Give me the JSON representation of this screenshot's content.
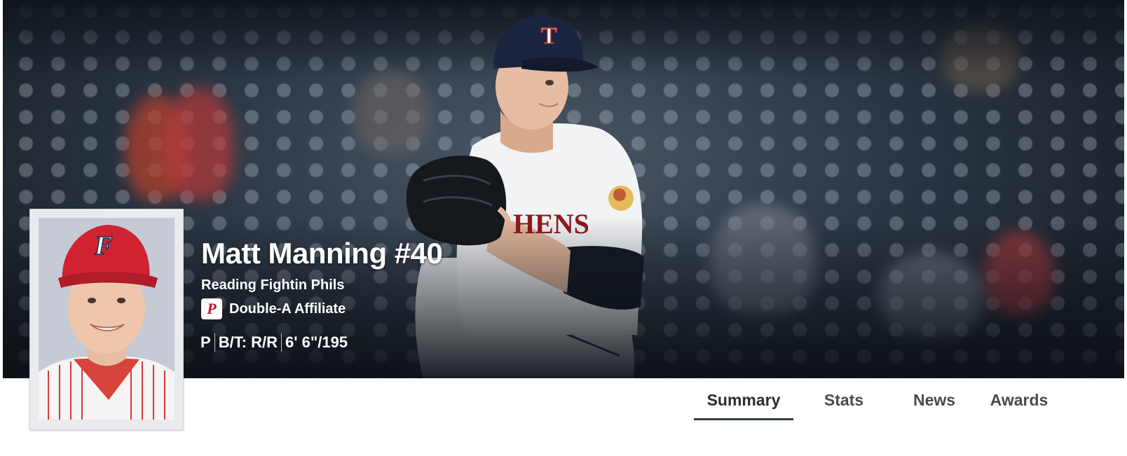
{
  "player": {
    "name_number": "Matt Manning #40",
    "team": "Reading Fightin Phils",
    "affiliate": "Double-A Affiliate",
    "affiliate_logo_letter": "P",
    "position": "P",
    "bats_throws": "B/T: R/R",
    "height_weight": "6' 6\"/195"
  },
  "cap_logo_letter": "T",
  "headshot_cap_letter": "F",
  "jersey_text": "HENS",
  "tabs": [
    {
      "label": "Summary",
      "active": true
    },
    {
      "label": "Stats",
      "active": false
    },
    {
      "label": "News",
      "active": false
    },
    {
      "label": "Awards",
      "active": false
    }
  ],
  "colors": {
    "tab_underline": "#333a42",
    "phillies_red": "#c8102e",
    "cap_navy": "#1b2540"
  }
}
